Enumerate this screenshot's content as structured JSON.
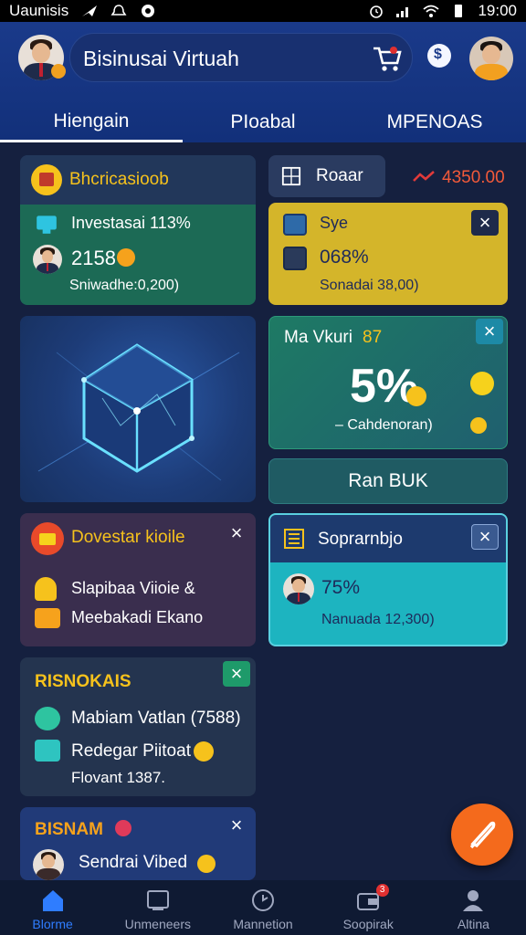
{
  "status_bar": {
    "carrier": "Uaunisis",
    "time": "19:00"
  },
  "header": {
    "title": "Bisinusai Virtuah"
  },
  "tabs": [
    {
      "label": "Hiengain",
      "active": true
    },
    {
      "label": "PIoabal",
      "active": false
    },
    {
      "label": "MPENOAS",
      "active": false
    }
  ],
  "investment_card": {
    "title": "Bhcricasioob",
    "row1": "Investasai 113%",
    "value": "2158",
    "subtitle": "Sniwadhe:0,200)"
  },
  "product_card": {
    "tab_label": "Roaar",
    "price": "4350.00",
    "row1": "Sye",
    "percent": "068%",
    "subtitle": "Sonadai 38,00)"
  },
  "percent_card": {
    "title": "Ma Vkuri",
    "title_accent": "87",
    "big_value": "5%",
    "caption": "– Cahdenoran)"
  },
  "run_button": {
    "label": "Ran BUK"
  },
  "investor_card": {
    "title": "Dovestar kioile",
    "row1": "Slapibaa Viioie  &",
    "row2": "Meebakadi Ekano"
  },
  "support_card": {
    "title": "Soprarnbjo",
    "percent": "75%",
    "subtitle": "Nanuada 12,300)"
  },
  "business_card": {
    "title": "RISNOKAIS",
    "row1": "Mabiam Vatlan (7588)",
    "row2": "Redegar Piitoat",
    "row3": "Flovant 1387."
  },
  "bisnam_card": {
    "title": "BISNAM",
    "row1": "Sendrai Vibed"
  },
  "bottom_nav": [
    {
      "label": "Blorme",
      "active": true
    },
    {
      "label": "Unmeneers",
      "active": false
    },
    {
      "label": "Mannetion",
      "active": false
    },
    {
      "label": "Soopirak",
      "active": false,
      "badge": "3"
    },
    {
      "label": "Altina",
      "active": false
    }
  ],
  "colors": {
    "header_blue": "#1a3a8a",
    "green_card": "#1c6a55",
    "yellow_card": "#d4b52a",
    "cyan_card": "#1db4c0",
    "accent_orange": "#f46a1c",
    "accent_yellow": "#f6c21c",
    "active_nav": "#2f7dff"
  }
}
